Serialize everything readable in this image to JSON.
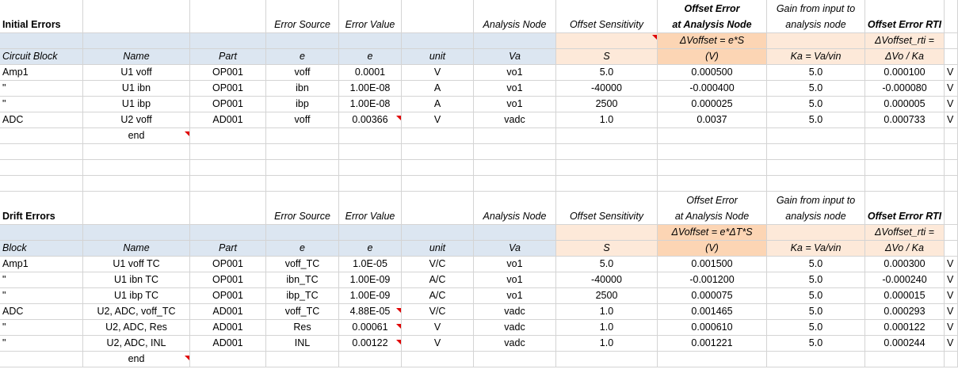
{
  "sections": [
    {
      "rows": [
        [
          "Initial Errors",
          "",
          "",
          "Error Source",
          "Error Value",
          "",
          "Analysis Node",
          "Offset Sensitivity",
          "Offset Error\nat Analysis Node",
          "Gain from input to\nanalysis node",
          "Offset Error RTI",
          ""
        ],
        [
          "",
          "",
          "",
          "",
          "",
          "",
          "",
          "",
          "ΔVoffset = e*S",
          "",
          "ΔVoffset_rti =",
          ""
        ],
        [
          "Circuit Block",
          "Name",
          "Part",
          "e",
          "e",
          "unit",
          "Va",
          "S",
          "(V)",
          "Ka = Va/vin",
          "ΔVo / Ka",
          ""
        ],
        [
          "Amp1",
          "U1 voff",
          "OP001",
          "voff",
          "0.0001",
          "V",
          "vo1",
          "5.0",
          "0.000500",
          "5.0",
          "0.000100",
          "V"
        ],
        [
          "\"",
          "U1 ibn",
          "OP001",
          "ibn",
          "1.00E-08",
          "A",
          "vo1",
          "-40000",
          "-0.000400",
          "5.0",
          "-0.000080",
          "V"
        ],
        [
          "\"",
          "U1 ibp",
          "OP001",
          "ibp",
          "1.00E-08",
          "A",
          "vo1",
          "2500",
          "0.000025",
          "5.0",
          "0.000005",
          "V"
        ],
        [
          "ADC",
          "U2 voff",
          "AD001",
          "voff",
          "0.00366",
          "V",
          "vadc",
          "1.0",
          "0.0037",
          "5.0",
          "0.000733",
          "V"
        ],
        [
          "",
          "end",
          "",
          "",
          "",
          "",
          "",
          "",
          "",
          "",
          "",
          ""
        ]
      ]
    },
    {
      "rows": [
        [
          "Drift Errors",
          "",
          "",
          "Error Source",
          "Error Value",
          "",
          "Analysis Node",
          "Offset Sensitivity",
          "Offset Error\nat Analysis Node",
          "Gain from input to\nanalysis node",
          "Offset Error RTI",
          ""
        ],
        [
          "",
          "",
          "",
          "",
          "",
          "",
          "",
          "",
          "ΔVoffset = e*ΔT*S",
          "",
          "ΔVoffset_rti =",
          ""
        ],
        [
          "Block",
          "Name",
          "Part",
          "e",
          "e",
          "unit",
          "Va",
          "S",
          "(V)",
          "Ka = Va/vin",
          "ΔVo / Ka",
          ""
        ],
        [
          "Amp1",
          "U1 voff TC",
          "OP001",
          "voff_TC",
          "1.0E-05",
          "V/C",
          "vo1",
          "5.0",
          "0.001500",
          "5.0",
          "0.000300",
          "V"
        ],
        [
          "\"",
          "U1 ibn TC",
          "OP001",
          "ibn_TC",
          "1.00E-09",
          "A/C",
          "vo1",
          "-40000",
          "-0.001200",
          "5.0",
          "-0.000240",
          "V"
        ],
        [
          "\"",
          "U1 ibp TC",
          "OP001",
          "ibp_TC",
          "1.00E-09",
          "A/C",
          "vo1",
          "2500",
          "0.000075",
          "5.0",
          "0.000015",
          "V"
        ],
        [
          "ADC",
          "U2, ADC, voff_TC",
          "AD001",
          "voff_TC",
          "4.88E-05",
          "V/C",
          "vadc",
          "1.0",
          "0.001465",
          "5.0",
          "0.000293",
          "V"
        ],
        [
          "\"",
          "U2, ADC, Res",
          "AD001",
          "Res",
          "0.00061",
          "V",
          "vadc",
          "1.0",
          "0.000610",
          "5.0",
          "0.000122",
          "V"
        ],
        [
          "\"",
          "U2, ADC, INL",
          "AD001",
          "INL",
          "0.00122",
          "V",
          "vadc",
          "1.0",
          "0.001221",
          "5.0",
          "0.000244",
          "V"
        ],
        [
          "",
          "end",
          "",
          "",
          "",
          "",
          "",
          "",
          "",
          "",
          "",
          ""
        ]
      ]
    }
  ]
}
